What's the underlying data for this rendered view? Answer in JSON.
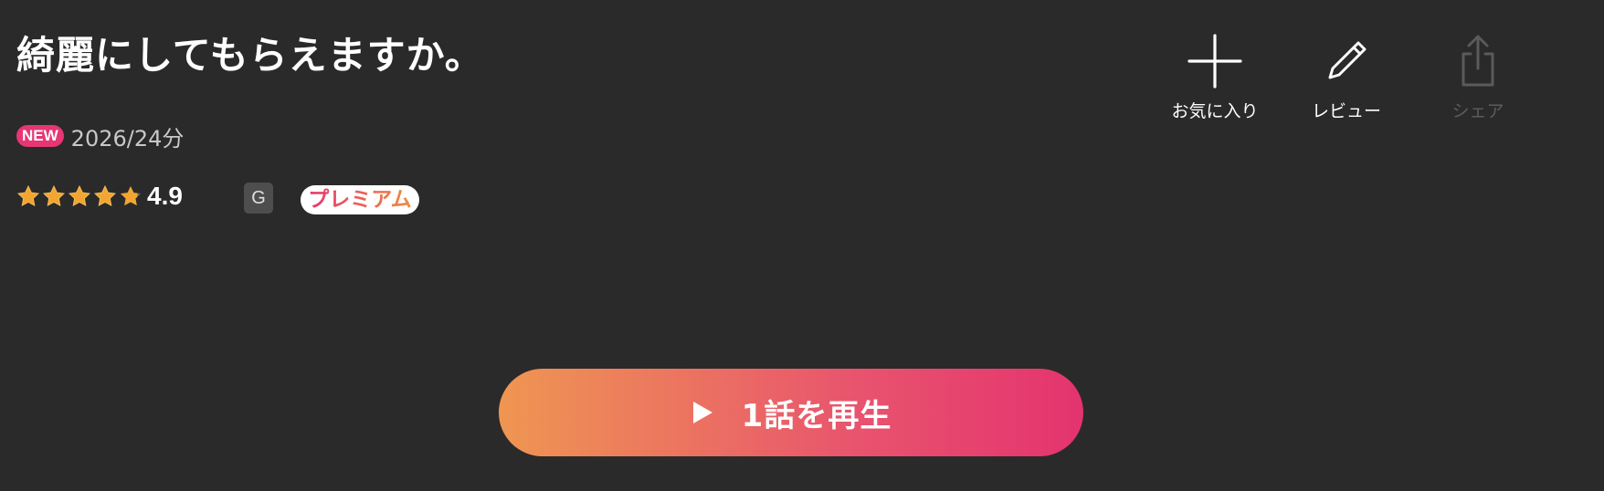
{
  "title": "綺麗にしてもらえますか。",
  "meta": {
    "new_badge": "NEW",
    "year_duration": "2026/24分"
  },
  "rating": {
    "value": "4.9",
    "stars": 4.9,
    "max_stars": 5,
    "age_rating": "G",
    "tier_label": "プレミアム"
  },
  "actions": {
    "favorite_label": "お気に入り",
    "favorite_icon": "plus-icon",
    "review_label": "レビュー",
    "review_icon": "pencil-icon",
    "share_label": "シェア",
    "share_icon": "share-icon",
    "share_enabled": false
  },
  "play_button": {
    "label": "1話を再生",
    "icon": "play-icon"
  },
  "colors": {
    "background": "#2a2a2a",
    "new_badge": "#e63673",
    "star": "#f2a531",
    "play_gradient_start": "#ef9652",
    "play_gradient_end": "#e4336f",
    "disabled_text": "#5c5c5c"
  }
}
